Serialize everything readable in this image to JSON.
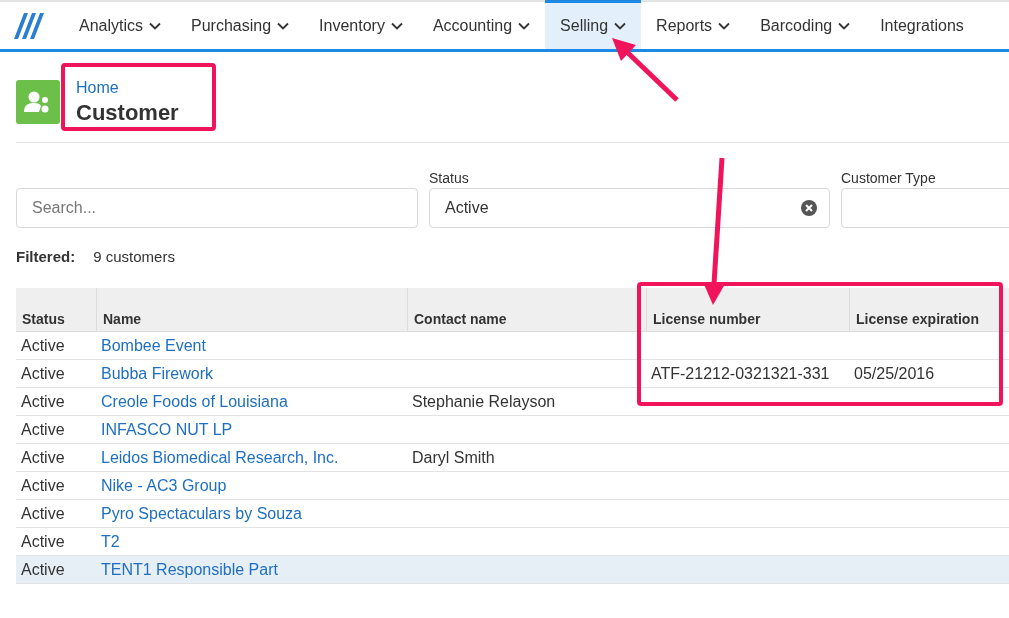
{
  "nav": {
    "items": [
      {
        "label": "Analytics",
        "dropdown": true,
        "selected": false
      },
      {
        "label": "Purchasing",
        "dropdown": true,
        "selected": false
      },
      {
        "label": "Inventory",
        "dropdown": true,
        "selected": false
      },
      {
        "label": "Accounting",
        "dropdown": true,
        "selected": false
      },
      {
        "label": "Selling",
        "dropdown": true,
        "selected": true
      },
      {
        "label": "Reports",
        "dropdown": true,
        "selected": false
      },
      {
        "label": "Barcoding",
        "dropdown": true,
        "selected": false
      },
      {
        "label": "Integrations",
        "dropdown": false,
        "selected": false
      }
    ]
  },
  "header": {
    "breadcrumb": "Home",
    "title": "Customer"
  },
  "filters": {
    "search": {
      "placeholder": "Search..."
    },
    "status": {
      "label": "Status",
      "value": "Active"
    },
    "customer_type": {
      "label": "Customer Type"
    }
  },
  "summary": {
    "label": "Filtered:",
    "value": "9 customers"
  },
  "table": {
    "columns": [
      "Status",
      "Name",
      "Contact name",
      "License number",
      "License expiration"
    ],
    "rows": [
      {
        "status": "Active",
        "name": "Bombee Event",
        "contact": "",
        "license_number": "",
        "license_expiration": "",
        "selected": false
      },
      {
        "status": "Active",
        "name": "Bubba Firework",
        "contact": "",
        "license_number": "ATF-21212-0321321-331",
        "license_expiration": "05/25/2016",
        "selected": false
      },
      {
        "status": "Active",
        "name": "Creole Foods of Louisiana",
        "contact": "Stephanie Relayson",
        "license_number": "",
        "license_expiration": "",
        "selected": false
      },
      {
        "status": "Active",
        "name": "INFASCO NUT LP",
        "contact": "",
        "license_number": "",
        "license_expiration": "",
        "selected": false
      },
      {
        "status": "Active",
        "name": "Leidos Biomedical Research, Inc.",
        "contact": "Daryl Smith",
        "license_number": "",
        "license_expiration": "",
        "selected": false
      },
      {
        "status": "Active",
        "name": "Nike - AC3 Group",
        "contact": "",
        "license_number": "",
        "license_expiration": "",
        "selected": false
      },
      {
        "status": "Active",
        "name": "Pyro Spectaculars by Souza",
        "contact": "",
        "license_number": "",
        "license_expiration": "",
        "selected": false
      },
      {
        "status": "Active",
        "name": "T2",
        "contact": "",
        "license_number": "",
        "license_expiration": "",
        "selected": false
      },
      {
        "status": "Active",
        "name": "TENT1 Responsible Part",
        "contact": "",
        "license_number": "",
        "license_expiration": "",
        "selected": true
      }
    ]
  }
}
